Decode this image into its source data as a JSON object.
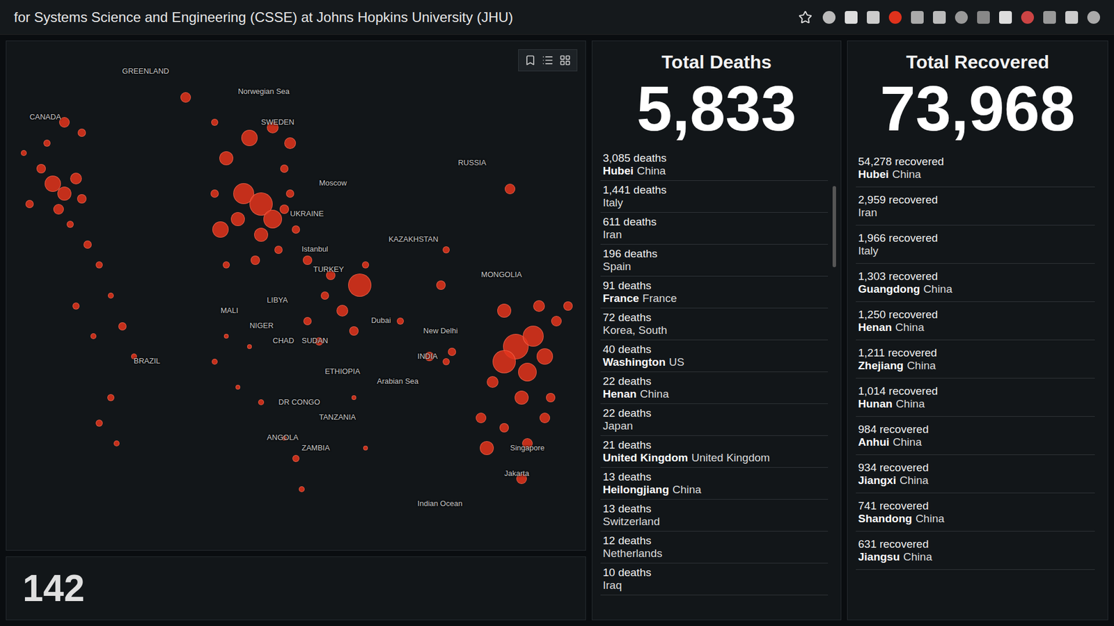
{
  "browser": {
    "title": "for Systems Science and Engineering (CSSE) at Johns Hopkins University (JHU)"
  },
  "map": {
    "labels": [
      "CANADA",
      "GREENLAND",
      "Norwegian Sea",
      "SWEDEN",
      "RUSSIA",
      "Moscow",
      "UKRAINE",
      "KAZAKHSTAN",
      "MONGOLIA",
      "Istanbul",
      "TURKEY",
      "LIBYA",
      "MALI",
      "NIGER",
      "CHAD",
      "SUDAN",
      "Dubai",
      "New Delhi",
      "INDIA",
      "Arabian Sea",
      "ETHIOPIA",
      "DR CONGO",
      "TANZANIA",
      "ANGOLA",
      "ZAMBIA",
      "Singapore",
      "Jakarta",
      "Indian Ocean",
      "BRAZIL"
    ]
  },
  "counter": {
    "value": "142"
  },
  "deaths": {
    "title": "Total Deaths",
    "total": "5,833",
    "items": [
      {
        "count": "3,085 deaths",
        "region": "Hubei",
        "country": "China"
      },
      {
        "count": "1,441 deaths",
        "region": "",
        "country": "Italy"
      },
      {
        "count": "611 deaths",
        "region": "",
        "country": "Iran"
      },
      {
        "count": "196 deaths",
        "region": "",
        "country": "Spain"
      },
      {
        "count": "91 deaths",
        "region": "France",
        "country": "France"
      },
      {
        "count": "72 deaths",
        "region": "",
        "country": "Korea, South"
      },
      {
        "count": "40 deaths",
        "region": "Washington",
        "country": "US"
      },
      {
        "count": "22 deaths",
        "region": "Henan",
        "country": "China"
      },
      {
        "count": "22 deaths",
        "region": "",
        "country": "Japan"
      },
      {
        "count": "21 deaths",
        "region": "United Kingdom",
        "country": "United Kingdom"
      },
      {
        "count": "13 deaths",
        "region": "Heilongjiang",
        "country": "China"
      },
      {
        "count": "13 deaths",
        "region": "",
        "country": "Switzerland"
      },
      {
        "count": "12 deaths",
        "region": "",
        "country": "Netherlands"
      },
      {
        "count": "10 deaths",
        "region": "",
        "country": "Iraq"
      }
    ]
  },
  "recovered": {
    "title": "Total Recovered",
    "total": "73,968",
    "items": [
      {
        "count": "54,278 recovered",
        "region": "Hubei",
        "country": "China"
      },
      {
        "count": "2,959 recovered",
        "region": "",
        "country": "Iran"
      },
      {
        "count": "1,966 recovered",
        "region": "",
        "country": "Italy"
      },
      {
        "count": "1,303 recovered",
        "region": "Guangdong",
        "country": "China"
      },
      {
        "count": "1,250 recovered",
        "region": "Henan",
        "country": "China"
      },
      {
        "count": "1,211 recovered",
        "region": "Zhejiang",
        "country": "China"
      },
      {
        "count": "1,014 recovered",
        "region": "Hunan",
        "country": "China"
      },
      {
        "count": "984 recovered",
        "region": "Anhui",
        "country": "China"
      },
      {
        "count": "934 recovered",
        "region": "Jiangxi",
        "country": "China"
      },
      {
        "count": "741 recovered",
        "region": "Shandong",
        "country": "China"
      },
      {
        "count": "631 recovered",
        "region": "Jiangsu",
        "country": "China"
      }
    ]
  }
}
